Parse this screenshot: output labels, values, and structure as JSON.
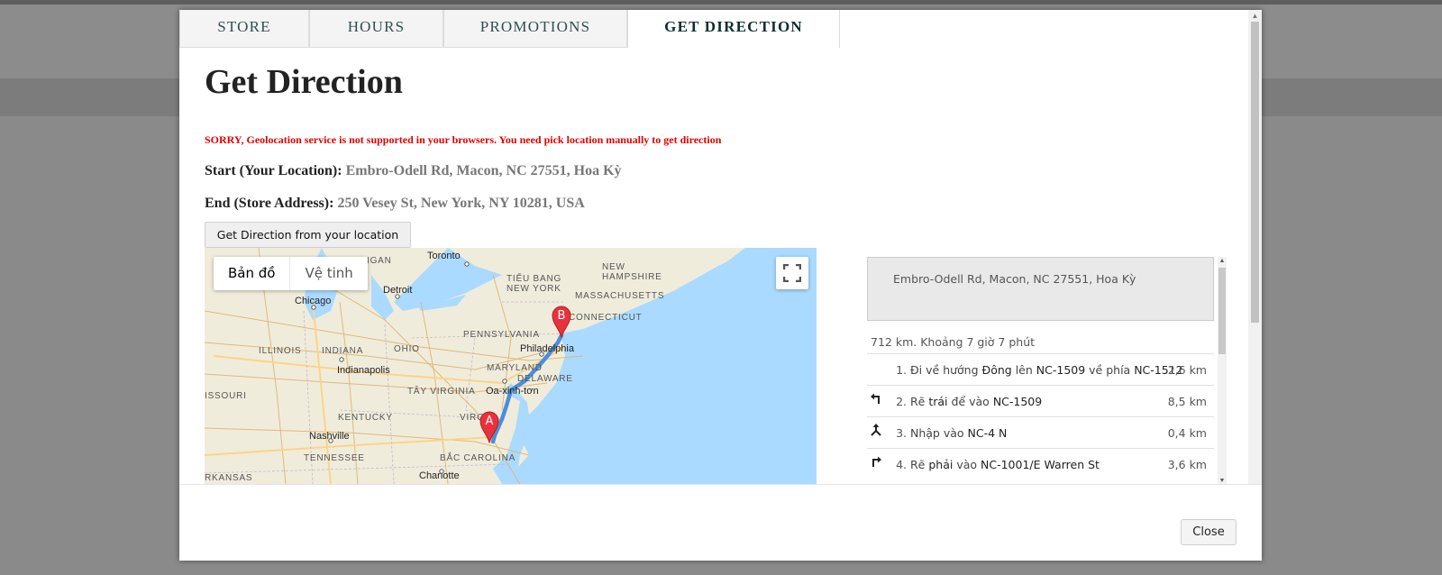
{
  "tabs": [
    {
      "label": "STORE"
    },
    {
      "label": "HOURS"
    },
    {
      "label": "PROMOTIONS"
    },
    {
      "label": "GET DIRECTION"
    }
  ],
  "page_title": "Get Direction",
  "error_message": "SORRY, Geolocation service is not supported in your browsers. You need pick location manually to get direction",
  "start": {
    "label": "Start (Your Location):",
    "value": "Embro-Odell Rd, Macon, NC 27551, Hoa Kỳ"
  },
  "end": {
    "label": "End (Store Address):",
    "value": "250 Vesey St, New York, NY 10281, USA"
  },
  "get_direction_button": "Get Direction from your location",
  "map": {
    "map_type_map": "Bản đồ",
    "map_type_satellite": "Vệ tinh",
    "marker_a": "A",
    "marker_b": "B",
    "places": {
      "toronto": "Toronto",
      "michigan": "HIGAN",
      "detroit": "Detroit",
      "chicago": "Chicago",
      "new_hampshire": "NEW\nHAMPSHIRE",
      "massachusetts": "MASSACHUSETTS",
      "tieu_bang_new_york": "TIỂU BANG\nNEW YORK",
      "connecticut": "CONNECTICUT",
      "pennsylvania": "PENNSYLVANIA",
      "ohio": "OHIO",
      "indiana": "INDIANA",
      "illinois": "ILLINOIS",
      "indianapolis": "Indianapolis",
      "philadelphia": "Philadelphia",
      "maryland": "MARYLAND",
      "delaware": "DELAWARE",
      "oa_xinh_ton": "Oa-xinh-tơn",
      "missouri": "ISSOURI",
      "tay_virginia": "TÂY VIRGINIA",
      "kentucky": "KENTUCKY",
      "virginia": "VIRGI",
      "nashville": "Nashville",
      "tennessee": "TENNESSEE",
      "bac_carolina": "BẮC CAROLINA",
      "charlotte": "Charlotte",
      "arkansas": "RKANSAS"
    }
  },
  "directions": {
    "origin": "Embro-Odell Rd, Macon, NC 27551, Hoa Kỳ",
    "summary": "712 km. Khoảng 7 giờ 7 phút",
    "steps": [
      {
        "icon": "",
        "num": "1.",
        "pre": "Đi về hướng ",
        "b1": "Đông",
        "mid": " lên ",
        "b2": "NC-1509",
        "mid2": " về phía ",
        "b3": "NC-1512",
        "dist": "2,6 km"
      },
      {
        "icon": "turn-left-icon",
        "num": "2.",
        "pre": "Rẽ ",
        "b1": "trái",
        "mid": " để vào ",
        "b2": "NC-1509",
        "mid2": "",
        "b3": "",
        "dist": "8,5 km"
      },
      {
        "icon": "merge-icon",
        "num": "3.",
        "pre": "Nhập vào ",
        "b1": "NC-4 N",
        "mid": "",
        "b2": "",
        "mid2": "",
        "b3": "",
        "dist": "0,4 km"
      },
      {
        "icon": "turn-right-icon",
        "num": "4.",
        "pre": "Rẽ ",
        "b1": "phải",
        "mid": " vào ",
        "b2": "NC-1001/E Warren St",
        "mid2": "",
        "b3": "",
        "dist": "3,6 km"
      }
    ]
  },
  "close_button": "Close",
  "colors": {
    "error": "#e00000",
    "route": "#4a8fdb",
    "marker": "#e8323c",
    "water": "#aadaff",
    "land": "#f0ecdc"
  }
}
